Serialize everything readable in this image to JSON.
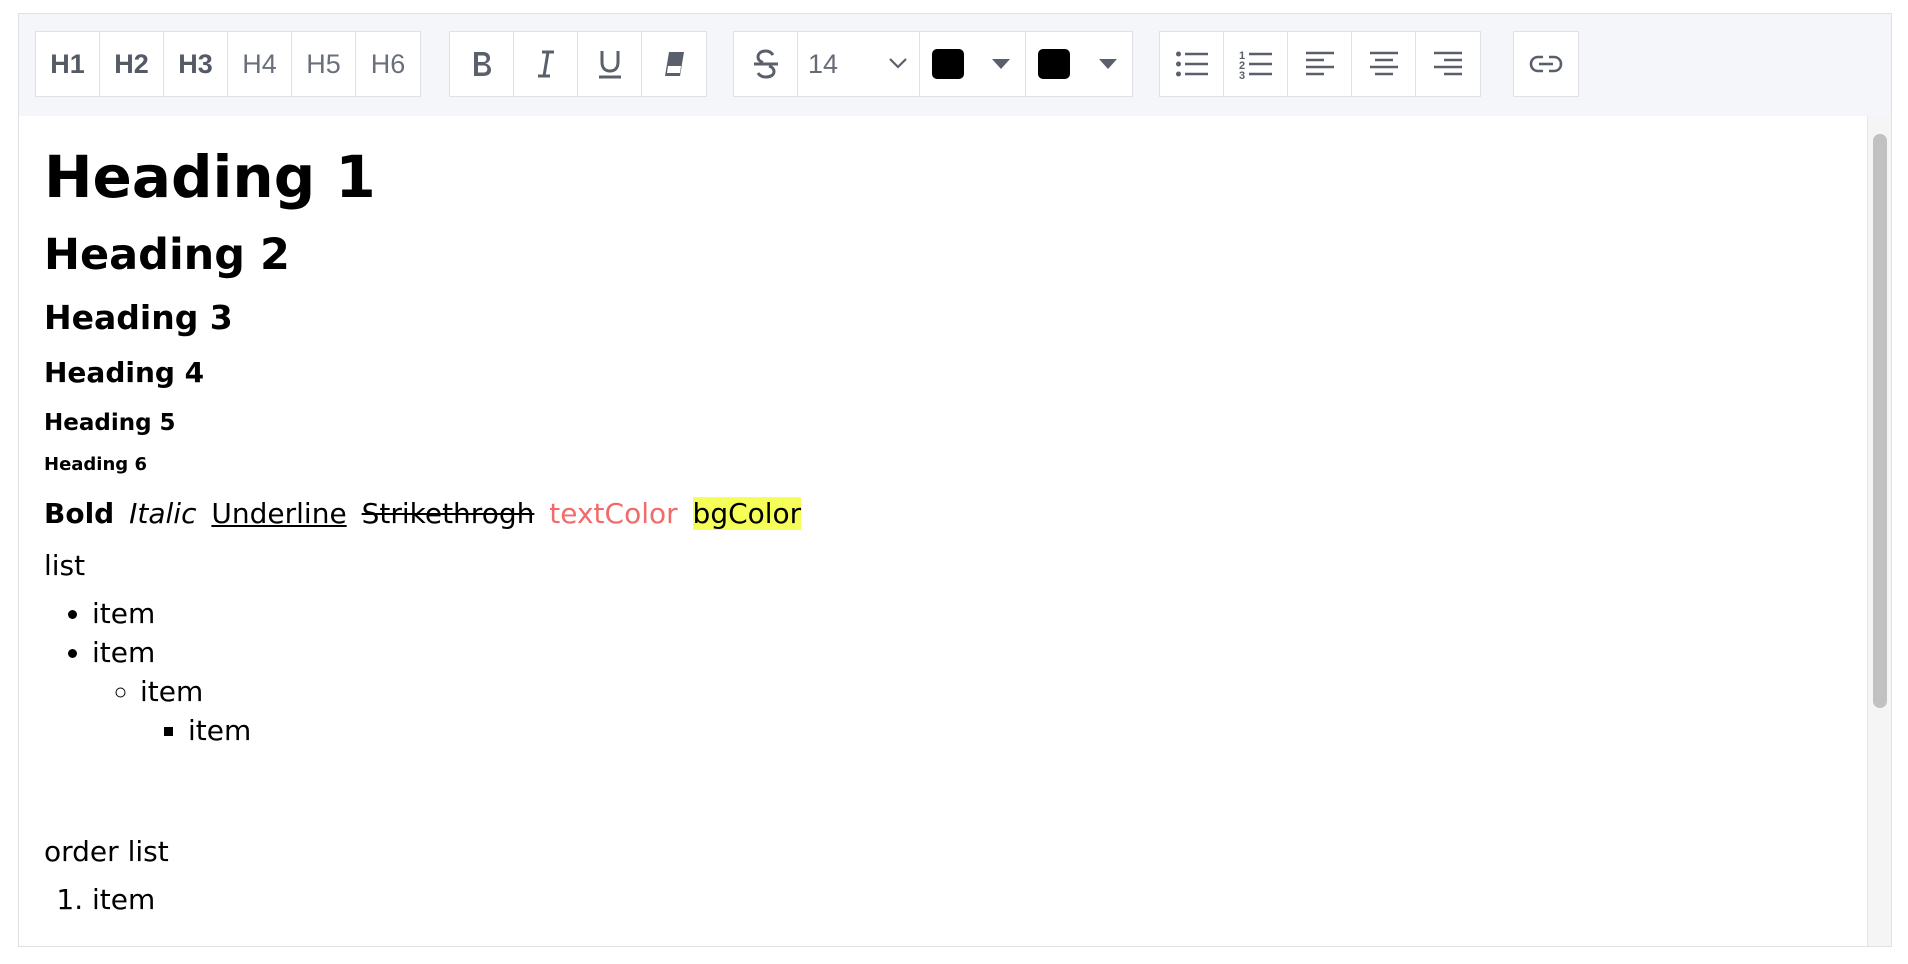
{
  "toolbar": {
    "headings": [
      "H1",
      "H2",
      "H3",
      "H4",
      "H5",
      "H6"
    ],
    "font_size": "14",
    "text_color": "#000000",
    "bg_color": "#000000"
  },
  "content": {
    "h1": "Heading 1",
    "h2": "Heading 2",
    "h3": "Heading 3",
    "h4": "Heading 4",
    "h5": "Heading 5",
    "h6": "Heading 6",
    "formats": {
      "bold": "Bold",
      "italic": "Italic",
      "underline": "Underline",
      "strike": "Strikethrogh",
      "text_color": "textColor",
      "bg_color": "bgColor"
    },
    "colors": {
      "text_color": "#f26b6b",
      "bg_color": "#f5ff57"
    },
    "list_label": "list",
    "list_items": [
      "item",
      "item",
      "item",
      "item"
    ],
    "ordered_label": "order list",
    "ordered_items": [
      "item"
    ]
  }
}
